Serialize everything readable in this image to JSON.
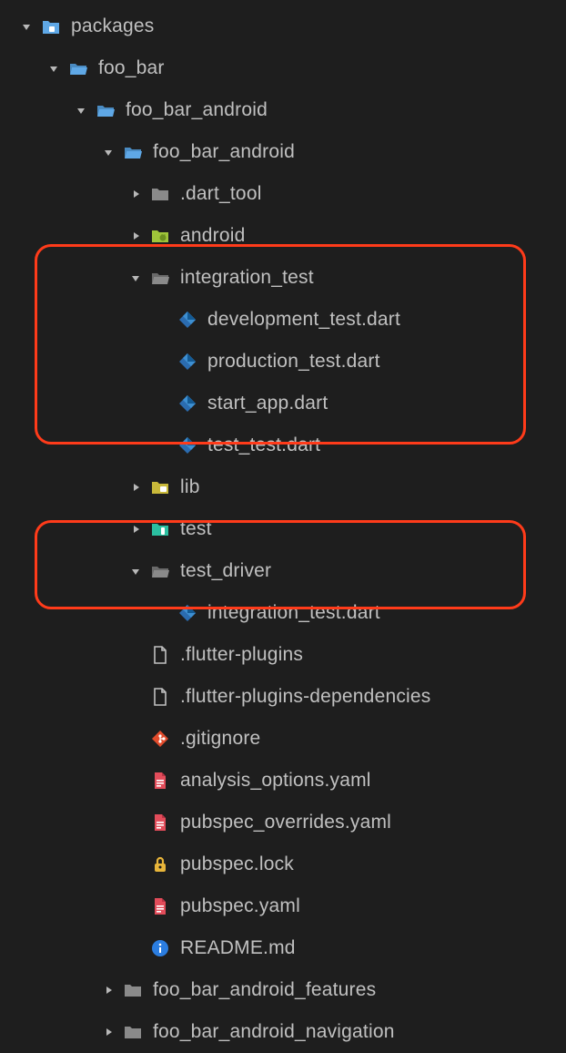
{
  "tree": [
    {
      "depth": 0,
      "chev": "down",
      "icon": "folder-package",
      "label": "packages"
    },
    {
      "depth": 1,
      "chev": "down",
      "icon": "folder-open",
      "label": "foo_bar"
    },
    {
      "depth": 2,
      "chev": "down",
      "icon": "folder-open",
      "label": "foo_bar_android"
    },
    {
      "depth": 3,
      "chev": "down",
      "icon": "folder-open",
      "label": "foo_bar_android"
    },
    {
      "depth": 4,
      "chev": "right",
      "icon": "folder-gray",
      "label": ".dart_tool"
    },
    {
      "depth": 4,
      "chev": "right",
      "icon": "android",
      "label": "android"
    },
    {
      "depth": 4,
      "chev": "down",
      "icon": "folder-open-gray",
      "label": "integration_test"
    },
    {
      "depth": 5,
      "chev": "none",
      "icon": "dart",
      "label": "development_test.dart"
    },
    {
      "depth": 5,
      "chev": "none",
      "icon": "dart",
      "label": "production_test.dart"
    },
    {
      "depth": 5,
      "chev": "none",
      "icon": "dart",
      "label": "start_app.dart"
    },
    {
      "depth": 5,
      "chev": "none",
      "icon": "dart",
      "label": "test_test.dart"
    },
    {
      "depth": 4,
      "chev": "right",
      "icon": "folder-lib",
      "label": "lib"
    },
    {
      "depth": 4,
      "chev": "right",
      "icon": "folder-test",
      "label": "test"
    },
    {
      "depth": 4,
      "chev": "down",
      "icon": "folder-open-gray",
      "label": "test_driver"
    },
    {
      "depth": 5,
      "chev": "none",
      "icon": "dart",
      "label": "integration_test.dart"
    },
    {
      "depth": 4,
      "chev": "none",
      "icon": "file",
      "label": ".flutter-plugins"
    },
    {
      "depth": 4,
      "chev": "none",
      "icon": "file",
      "label": ".flutter-plugins-dependencies"
    },
    {
      "depth": 4,
      "chev": "none",
      "icon": "git",
      "label": ".gitignore"
    },
    {
      "depth": 4,
      "chev": "none",
      "icon": "yaml",
      "label": "analysis_options.yaml"
    },
    {
      "depth": 4,
      "chev": "none",
      "icon": "yaml",
      "label": "pubspec_overrides.yaml"
    },
    {
      "depth": 4,
      "chev": "none",
      "icon": "lock",
      "label": "pubspec.lock"
    },
    {
      "depth": 4,
      "chev": "none",
      "icon": "yaml",
      "label": "pubspec.yaml"
    },
    {
      "depth": 4,
      "chev": "none",
      "icon": "info",
      "label": "README.md"
    },
    {
      "depth": 3,
      "chev": "right",
      "icon": "folder-gray",
      "label": "foo_bar_android_features"
    },
    {
      "depth": 3,
      "chev": "right",
      "icon": "folder-gray",
      "label": "foo_bar_android_navigation"
    }
  ]
}
